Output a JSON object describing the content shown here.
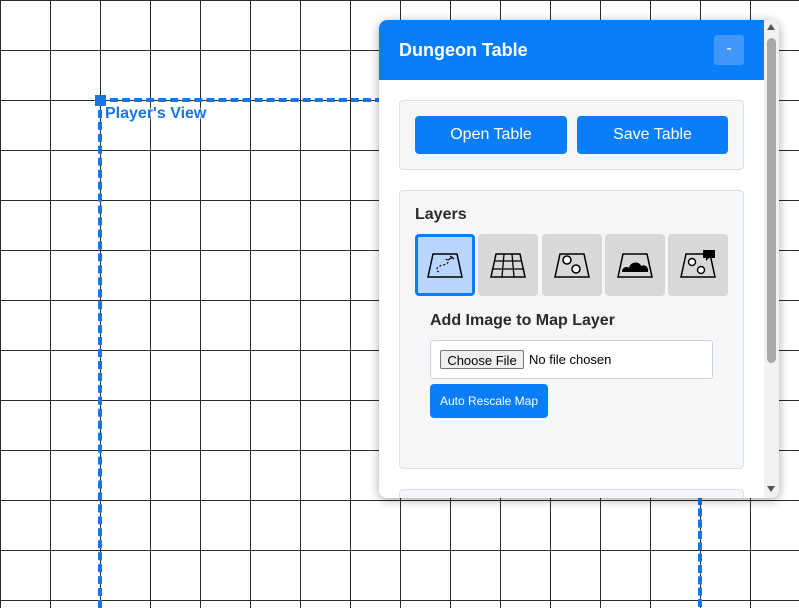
{
  "canvas": {
    "player_view_label": "Player's View"
  },
  "panel": {
    "title": "Dungeon Table",
    "minimize_label": "-",
    "buttons": {
      "open": "Open Table",
      "save": "Save Table"
    },
    "layers": {
      "title": "Layers",
      "tiles": [
        {
          "icon": "map-path-icon",
          "active": true
        },
        {
          "icon": "grid-icon",
          "active": false
        },
        {
          "icon": "tokens-icon",
          "active": false
        },
        {
          "icon": "fog-icon",
          "active": false
        },
        {
          "icon": "tokens-chat-icon",
          "active": false
        }
      ]
    },
    "add_image": {
      "title": "Add Image to Map Layer",
      "choose_file_label": "Choose File",
      "no_file_text": "No file chosen",
      "auto_rescale_label": "Auto Rescale Map"
    }
  },
  "colors": {
    "accent": "#0a7df8",
    "player_view_frame": "#1676e8",
    "grid_line": "#2b2b2b",
    "active_tile": "#b8d6ff"
  }
}
